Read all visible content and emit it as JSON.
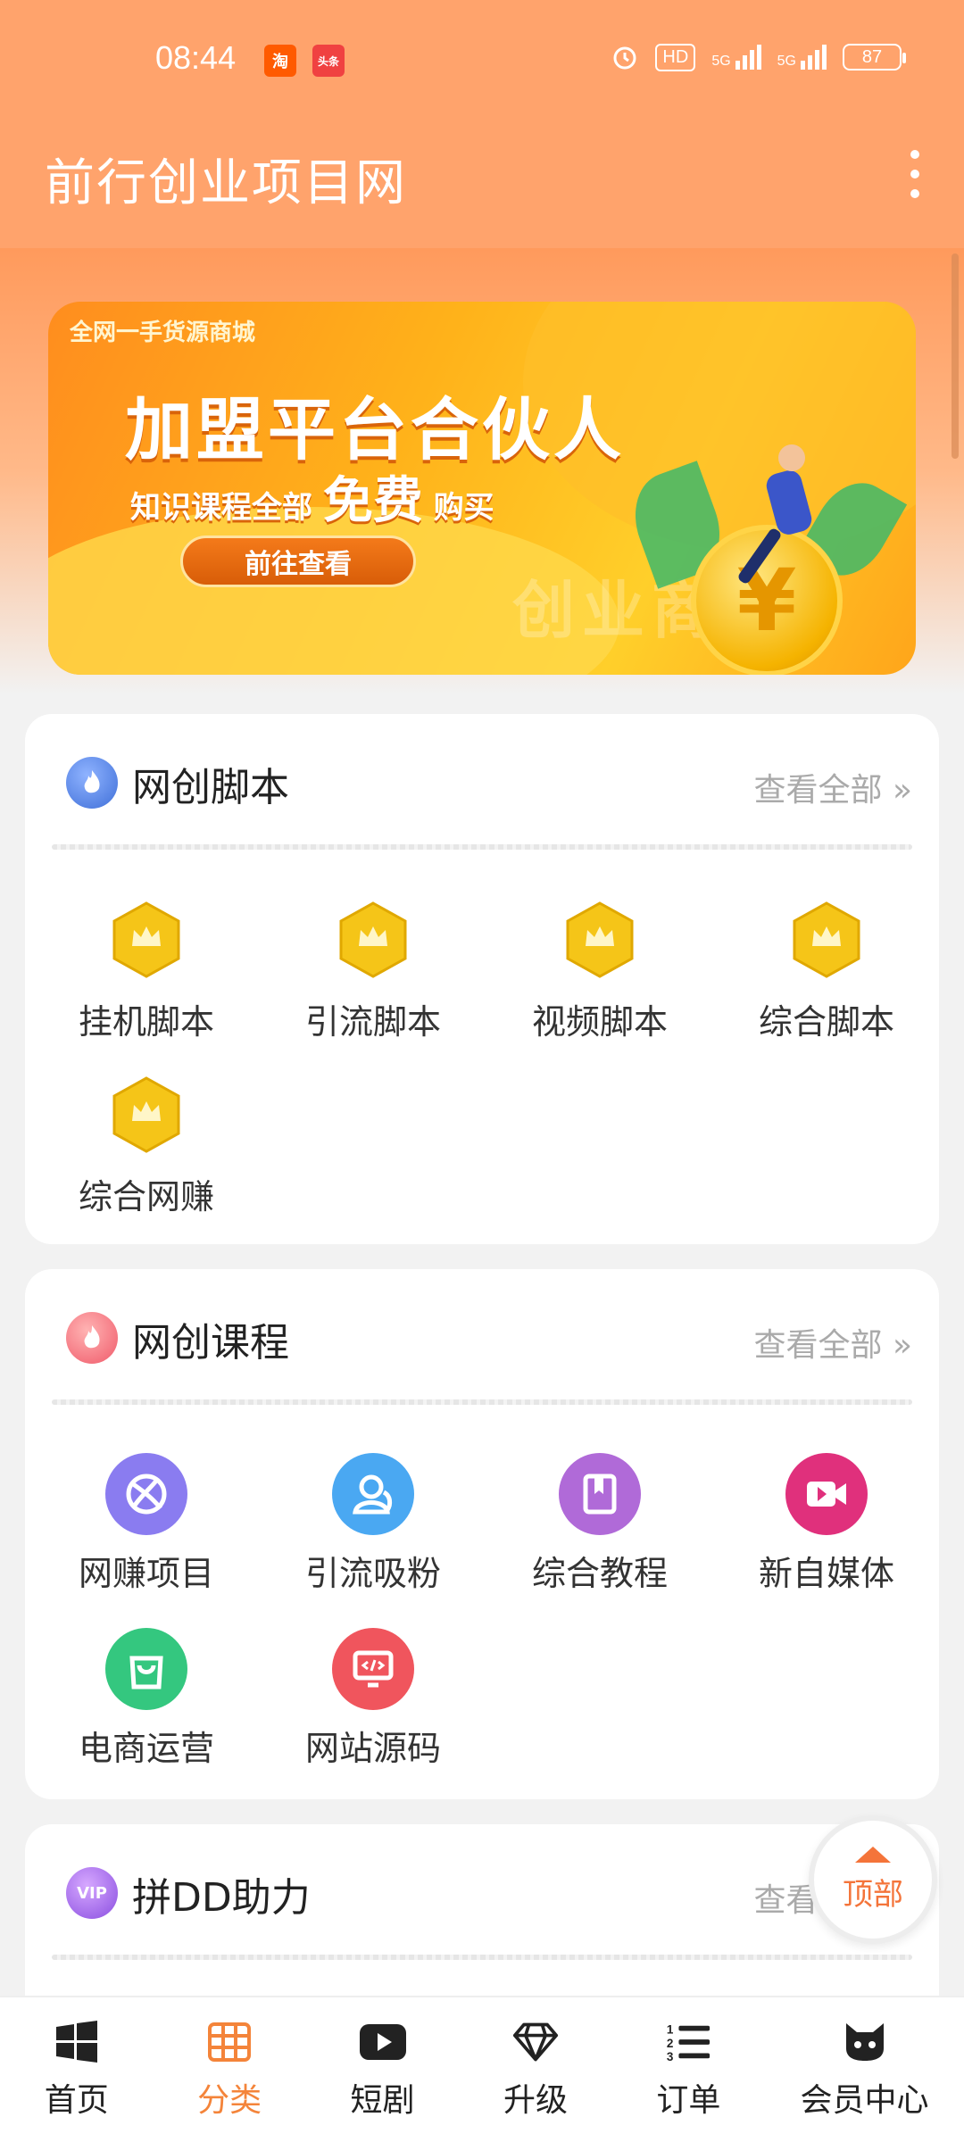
{
  "status_bar": {
    "time": "08:44",
    "app1": "淘",
    "app2": "头条",
    "hd": "HD",
    "net1": "5G",
    "net2": "5G",
    "battery": "87"
  },
  "app_bar": {
    "title": "前行创业项目网"
  },
  "banner": {
    "tag": "全网一手货源商城",
    "headline": "加盟平台合伙人",
    "sub_prefix": "知识课程全部",
    "sub_highlight": "免费",
    "sub_suffix": "购买",
    "button": "前往查看",
    "watermark": "创业商城",
    "coin_symbol": "¥"
  },
  "sections": [
    {
      "title": "网创脚本",
      "more": "查看全部 »",
      "items": [
        "挂机脚本",
        "引流脚本",
        "视频脚本",
        "综合脚本",
        "综合网赚"
      ]
    },
    {
      "title": "网创课程",
      "more": "查看全部 »",
      "items": [
        "网赚项目",
        "引流吸粉",
        "综合教程",
        "新自媒体",
        "电商运营",
        "网站源码"
      ]
    },
    {
      "title": "拼DD助力",
      "more": "查看全部 »",
      "icon_text": "VIP"
    }
  ],
  "top_button": "顶部",
  "bottom_nav": [
    {
      "label": "首页",
      "icon": "windows-icon"
    },
    {
      "label": "分类",
      "icon": "grid-icon",
      "active": true
    },
    {
      "label": "短剧",
      "icon": "play-icon"
    },
    {
      "label": "升级",
      "icon": "diamond-icon"
    },
    {
      "label": "订单",
      "icon": "list-icon"
    },
    {
      "label": "会员中心",
      "icon": "cat-icon"
    }
  ],
  "colors": {
    "header": "#ffa36c",
    "accent": "#f4843a",
    "gold": "#f5c518"
  }
}
